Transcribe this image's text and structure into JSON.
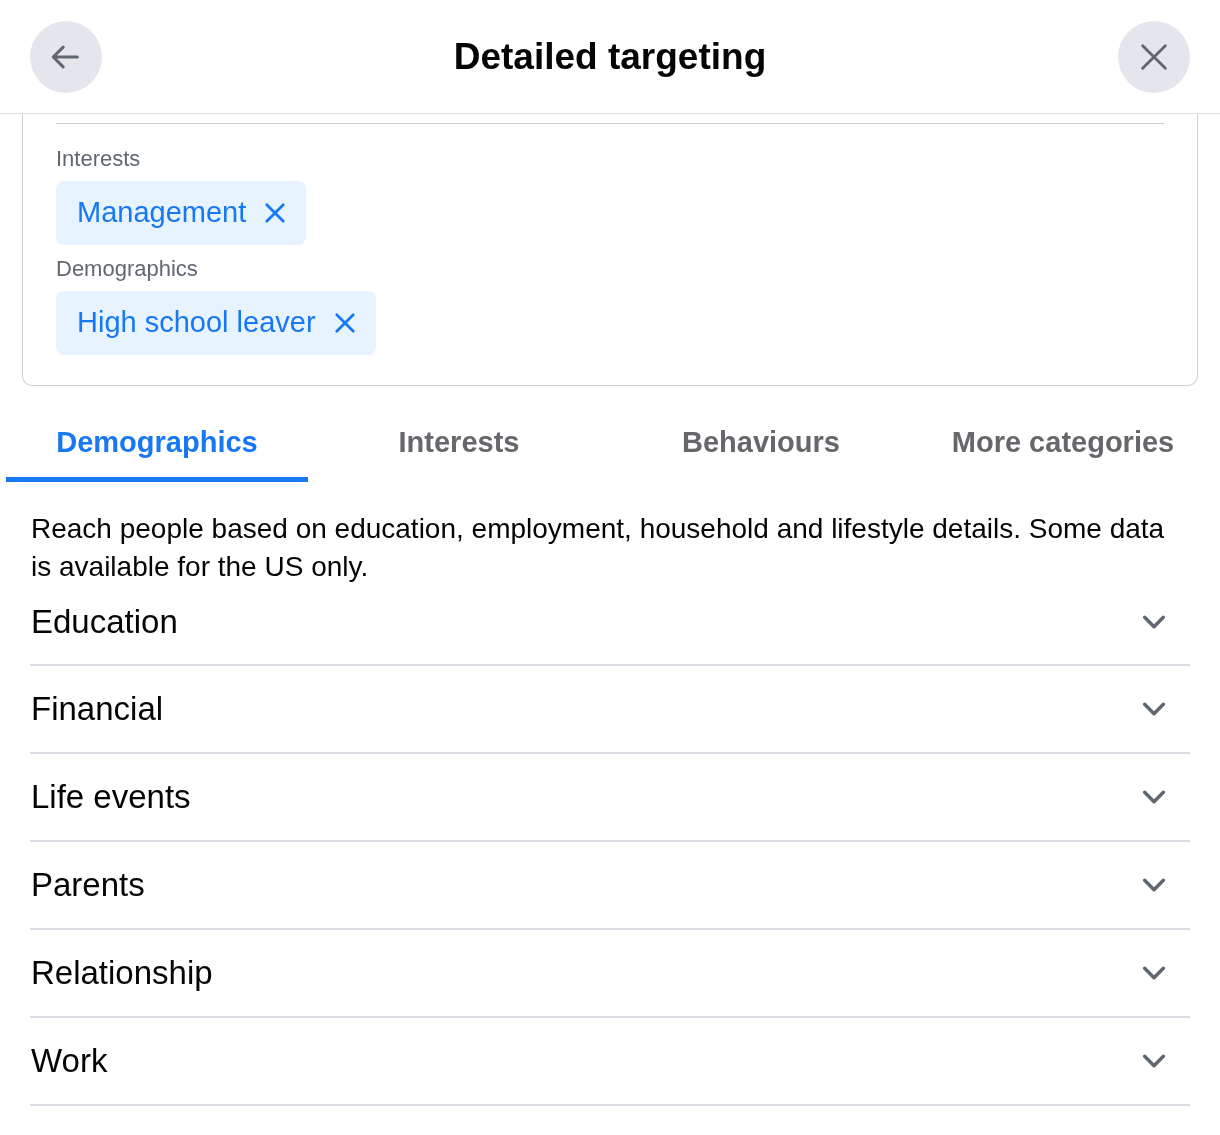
{
  "header": {
    "title": "Detailed targeting"
  },
  "selected": [
    {
      "label": "Interests",
      "chips": [
        "Management"
      ]
    },
    {
      "label": "Demographics",
      "chips": [
        "High school leaver"
      ]
    }
  ],
  "tabs": [
    {
      "label": "Demographics",
      "selected": true
    },
    {
      "label": "Interests",
      "selected": false
    },
    {
      "label": "Behaviours",
      "selected": false
    },
    {
      "label": "More categories",
      "selected": false
    }
  ],
  "description": "Reach people based on education, employment, household and lifestyle details. Some data is available for the US only.",
  "categories": [
    {
      "label": "Education",
      "expanded": false
    },
    {
      "label": "Financial",
      "expanded": false
    },
    {
      "label": "Life events",
      "expanded": false
    },
    {
      "label": "Parents",
      "expanded": false
    },
    {
      "label": "Relationship",
      "expanded": false
    },
    {
      "label": "Work",
      "expanded": false
    }
  ]
}
